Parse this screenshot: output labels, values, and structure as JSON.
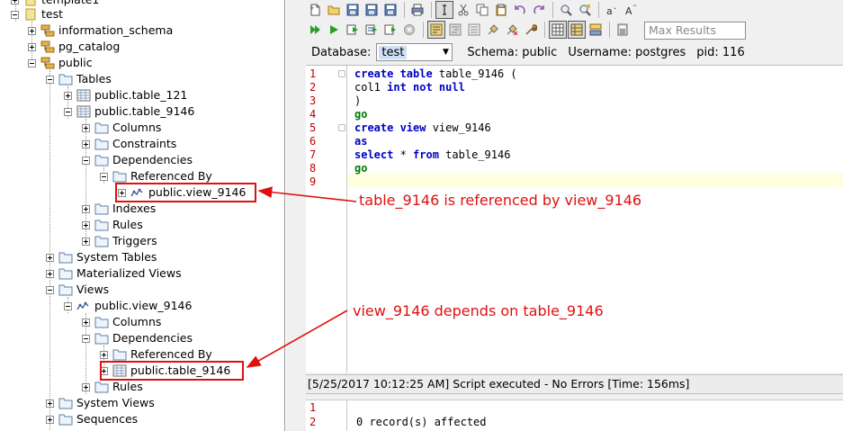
{
  "tree": {
    "nodes": [
      {
        "id": "template1",
        "label": "template1"
      },
      {
        "id": "test",
        "label": "test"
      },
      {
        "id": "information-schema",
        "label": "information_schema"
      },
      {
        "id": "pg-catalog",
        "label": "pg_catalog"
      },
      {
        "id": "public",
        "label": "public"
      },
      {
        "id": "tables",
        "label": "Tables"
      },
      {
        "id": "table-121",
        "label": "public.table_121"
      },
      {
        "id": "table-9146",
        "label": "public.table_9146"
      },
      {
        "id": "columns",
        "label": "Columns"
      },
      {
        "id": "constraints",
        "label": "Constraints"
      },
      {
        "id": "dependencies",
        "label": "Dependencies"
      },
      {
        "id": "referenced-by",
        "label": "Referenced By"
      },
      {
        "id": "ref-view-9146",
        "label": "public.view_9146"
      },
      {
        "id": "indexes",
        "label": "Indexes"
      },
      {
        "id": "rules",
        "label": "Rules"
      },
      {
        "id": "triggers",
        "label": "Triggers"
      },
      {
        "id": "system-tables",
        "label": "System Tables"
      },
      {
        "id": "materialized-views",
        "label": "Materialized Views"
      },
      {
        "id": "views",
        "label": "Views"
      },
      {
        "id": "view-9146",
        "label": "public.view_9146"
      },
      {
        "id": "view-columns",
        "label": "Columns"
      },
      {
        "id": "view-dependencies",
        "label": "Dependencies"
      },
      {
        "id": "view-referenced-by",
        "label": "Referenced By"
      },
      {
        "id": "dep-table-9146",
        "label": "public.table_9146"
      },
      {
        "id": "view-rules",
        "label": "Rules"
      },
      {
        "id": "system-views",
        "label": "System Views"
      },
      {
        "id": "sequences",
        "label": "Sequences"
      }
    ]
  },
  "annotations": {
    "table_ref": "table_9146 is referenced by view_9146",
    "view_dep": "view_9146 depends on table_9146"
  },
  "toolbar": {
    "max_results_placeholder": "Max Results"
  },
  "connection": {
    "database_label": "Database:",
    "database_value": "test",
    "schema": "Schema: public",
    "username": "Username: postgres",
    "pid": "pid: 116"
  },
  "editor": {
    "lines": [
      {
        "num": "1",
        "tokens": [
          {
            "t": "create table",
            "c": "kw"
          },
          {
            "t": " table_9146 (",
            "c": ""
          }
        ]
      },
      {
        "num": "2",
        "tokens": [
          {
            "t": "col1 ",
            "c": ""
          },
          {
            "t": "int not null",
            "c": "kw"
          }
        ]
      },
      {
        "num": "3",
        "tokens": [
          {
            "t": ")",
            "c": ""
          }
        ]
      },
      {
        "num": "4",
        "tokens": [
          {
            "t": "go",
            "c": "kg"
          }
        ]
      },
      {
        "num": "5",
        "tokens": [
          {
            "t": "create view",
            "c": "kw"
          },
          {
            "t": " view_9146",
            "c": ""
          }
        ]
      },
      {
        "num": "6",
        "tokens": [
          {
            "t": "as",
            "c": "kw"
          }
        ]
      },
      {
        "num": "7",
        "tokens": [
          {
            "t": "select",
            "c": "kw"
          },
          {
            "t": " * ",
            "c": ""
          },
          {
            "t": "from",
            "c": "kw"
          },
          {
            "t": " table_9146",
            "c": ""
          }
        ]
      },
      {
        "num": "8",
        "tokens": [
          {
            "t": "go",
            "c": "kg"
          }
        ]
      },
      {
        "num": "9",
        "tokens": []
      }
    ]
  },
  "status": {
    "message": "[5/25/2017 10:12:25 AM] Script executed - No Errors [Time: 156ms]"
  },
  "output": {
    "line1": "1",
    "line2": "2",
    "text": "0 record(s) affected"
  },
  "colors": {
    "annotation": "#e01010",
    "keyword": "#0000c8",
    "go_keyword": "#007a00",
    "line_number": "#c00000"
  }
}
